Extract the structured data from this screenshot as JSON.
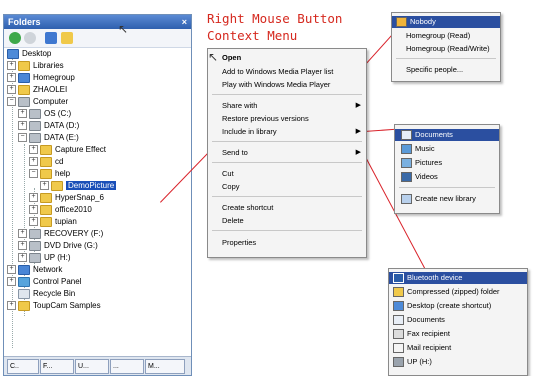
{
  "folders": {
    "title": "Folders",
    "close": "×",
    "tree": [
      {
        "label": "Desktop"
      },
      {
        "label": "Libraries"
      },
      {
        "label": "Homegroup"
      },
      {
        "label": "ZHAOLEI"
      },
      {
        "label": "Computer"
      },
      {
        "label": "OS (C:)"
      },
      {
        "label": "DATA (D:)"
      },
      {
        "label": "DATA (E:)"
      },
      {
        "label": "Capture Effect"
      },
      {
        "label": "cd"
      },
      {
        "label": "help"
      },
      {
        "label": "DemoPicture"
      },
      {
        "label": "HyperSnap_6"
      },
      {
        "label": "office2010"
      },
      {
        "label": "tupian"
      },
      {
        "label": "RECOVERY (F:)"
      },
      {
        "label": "DVD Drive (G:)"
      },
      {
        "label": "UP (H:)"
      },
      {
        "label": "Network"
      },
      {
        "label": "Control Panel"
      },
      {
        "label": "Recycle Bin"
      },
      {
        "label": "ToupCam Samples"
      }
    ],
    "taskbar": [
      "C..",
      "F...",
      "U...",
      "...",
      "M..."
    ]
  },
  "annotation": {
    "line1": "Right Mouse Button",
    "line2": "Context Menu"
  },
  "context_menu": {
    "items": [
      {
        "label": "Open"
      },
      {
        "label": "Add to Windows Media Player list"
      },
      {
        "label": "Play with Windows Media Player"
      },
      {
        "label": "Share with"
      },
      {
        "label": "Restore previous versions"
      },
      {
        "label": "Include in library"
      },
      {
        "label": "Send to"
      },
      {
        "label": "Cut"
      },
      {
        "label": "Copy"
      },
      {
        "label": "Create shortcut"
      },
      {
        "label": "Delete"
      },
      {
        "label": "Properties"
      }
    ]
  },
  "share_menu": {
    "items": [
      {
        "label": "Nobody"
      },
      {
        "label": "Homegroup (Read)"
      },
      {
        "label": "Homegroup (Read/Write)"
      },
      {
        "label": "Specific people..."
      }
    ]
  },
  "library_menu": {
    "items": [
      {
        "label": "Documents"
      },
      {
        "label": "Music"
      },
      {
        "label": "Pictures"
      },
      {
        "label": "Videos"
      },
      {
        "label": "Create new library"
      }
    ]
  },
  "sendto_menu": {
    "items": [
      {
        "label": "Bluetooth device"
      },
      {
        "label": "Compressed (zipped) folder"
      },
      {
        "label": "Desktop (create shortcut)"
      },
      {
        "label": "Documents"
      },
      {
        "label": "Fax recipient"
      },
      {
        "label": "Mail recipient"
      },
      {
        "label": "UP (H:)"
      }
    ]
  },
  "colors": {
    "annotation": "#d5281e",
    "highlight": "#2b4fa0",
    "selection": "#1a4fb8"
  }
}
